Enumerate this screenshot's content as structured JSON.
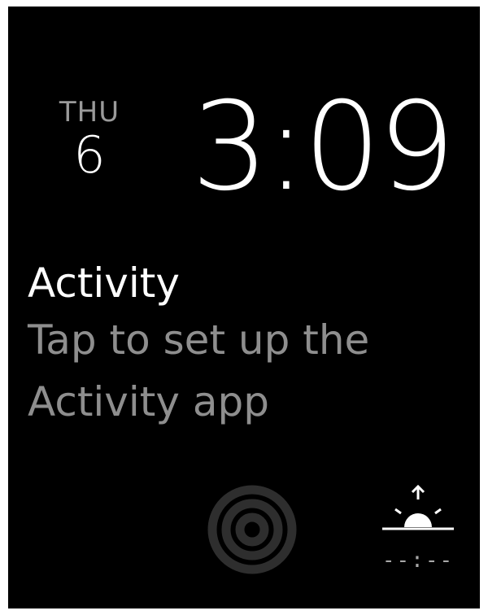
{
  "watch_face": {
    "date": {
      "weekday": "THU",
      "day": "6"
    },
    "time": "3:09",
    "activity_complication": {
      "title": "Activity",
      "body": "Tap to set up the Activity app"
    },
    "sunrise_complication": {
      "icon": "sunrise-icon",
      "time": "--:--"
    },
    "activity_rings_icon": "activity-rings-icon"
  },
  "colors": {
    "background": "#000000",
    "primary_text": "#ffffff",
    "secondary_text": "#8e8e8e"
  }
}
